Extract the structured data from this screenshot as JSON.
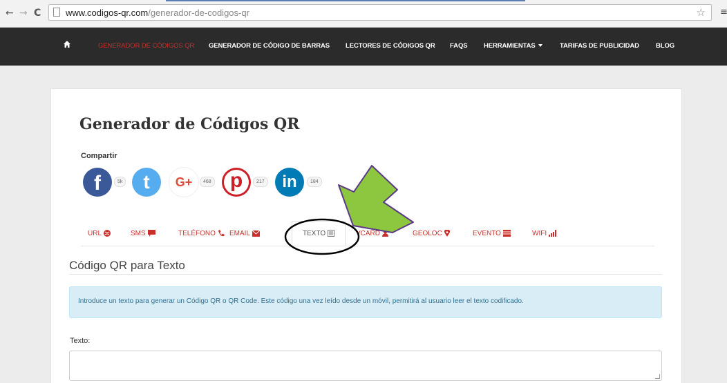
{
  "browser": {
    "back_glyph": "←",
    "forward_glyph": "→",
    "reload_glyph": "C",
    "url_host": "www.codigos-qr.com",
    "url_path": "/generador-de-codigos-qr",
    "star_glyph": "☆",
    "menu_glyph": "≡"
  },
  "navbar": {
    "items": [
      {
        "label": "GENERADOR DE CÓDIGOS QR"
      },
      {
        "label": "GENERADOR DE CÓDIGO DE BARRAS"
      },
      {
        "label": "LECTORES DE CÓDIGOS QR"
      },
      {
        "label": "FAQS"
      },
      {
        "label": "HERRAMIENTAS"
      },
      {
        "label": "TARIFAS DE PUBLICIDAD"
      },
      {
        "label": "BLOG"
      }
    ],
    "active_color": "#c9302c"
  },
  "page": {
    "title": "Generador de Códigos QR",
    "share_label": "Compartir"
  },
  "social": [
    {
      "network": "facebook",
      "glyph": "f",
      "count": "5k",
      "color": "#3b5998"
    },
    {
      "network": "twitter",
      "glyph": "t",
      "count": "",
      "color": "#55acee"
    },
    {
      "network": "google-plus",
      "glyph": "G+",
      "count": "468",
      "color": "#dd4b39"
    },
    {
      "network": "pinterest",
      "glyph": "p",
      "count": "217",
      "color": "#cb2027"
    },
    {
      "network": "linkedin",
      "glyph": "in",
      "count": "184",
      "color": "#007bb6"
    }
  ],
  "tabs": [
    {
      "label": "URL",
      "icon": "globe-icon"
    },
    {
      "label": "SMS",
      "icon": "comment-icon"
    },
    {
      "label": "TELÉFONO",
      "icon": "phone-icon"
    },
    {
      "label": "EMAIL",
      "icon": "envelope-icon"
    },
    {
      "label": "TEXTO",
      "icon": "text-doc-icon",
      "active": true
    },
    {
      "label": "VCARD",
      "icon": "user-icon"
    },
    {
      "label": "GEOLOC",
      "icon": "map-marker-icon"
    },
    {
      "label": "EVENTO",
      "icon": "calendar-icon"
    },
    {
      "label": "WIFI",
      "icon": "signal-icon"
    }
  ],
  "section": {
    "title": "Código QR para Texto",
    "info": "Introduce un texto para generar un Código QR o QR Code. Este código una vez leído desde un móvil, permitirá al usuario leer el texto codificado.",
    "field_label": "Texto:",
    "field_value": ""
  },
  "annotation": {
    "arrow_color": "#8dc63f",
    "arrow_outline": "#5b3a87",
    "ellipse_color": "#000000"
  }
}
